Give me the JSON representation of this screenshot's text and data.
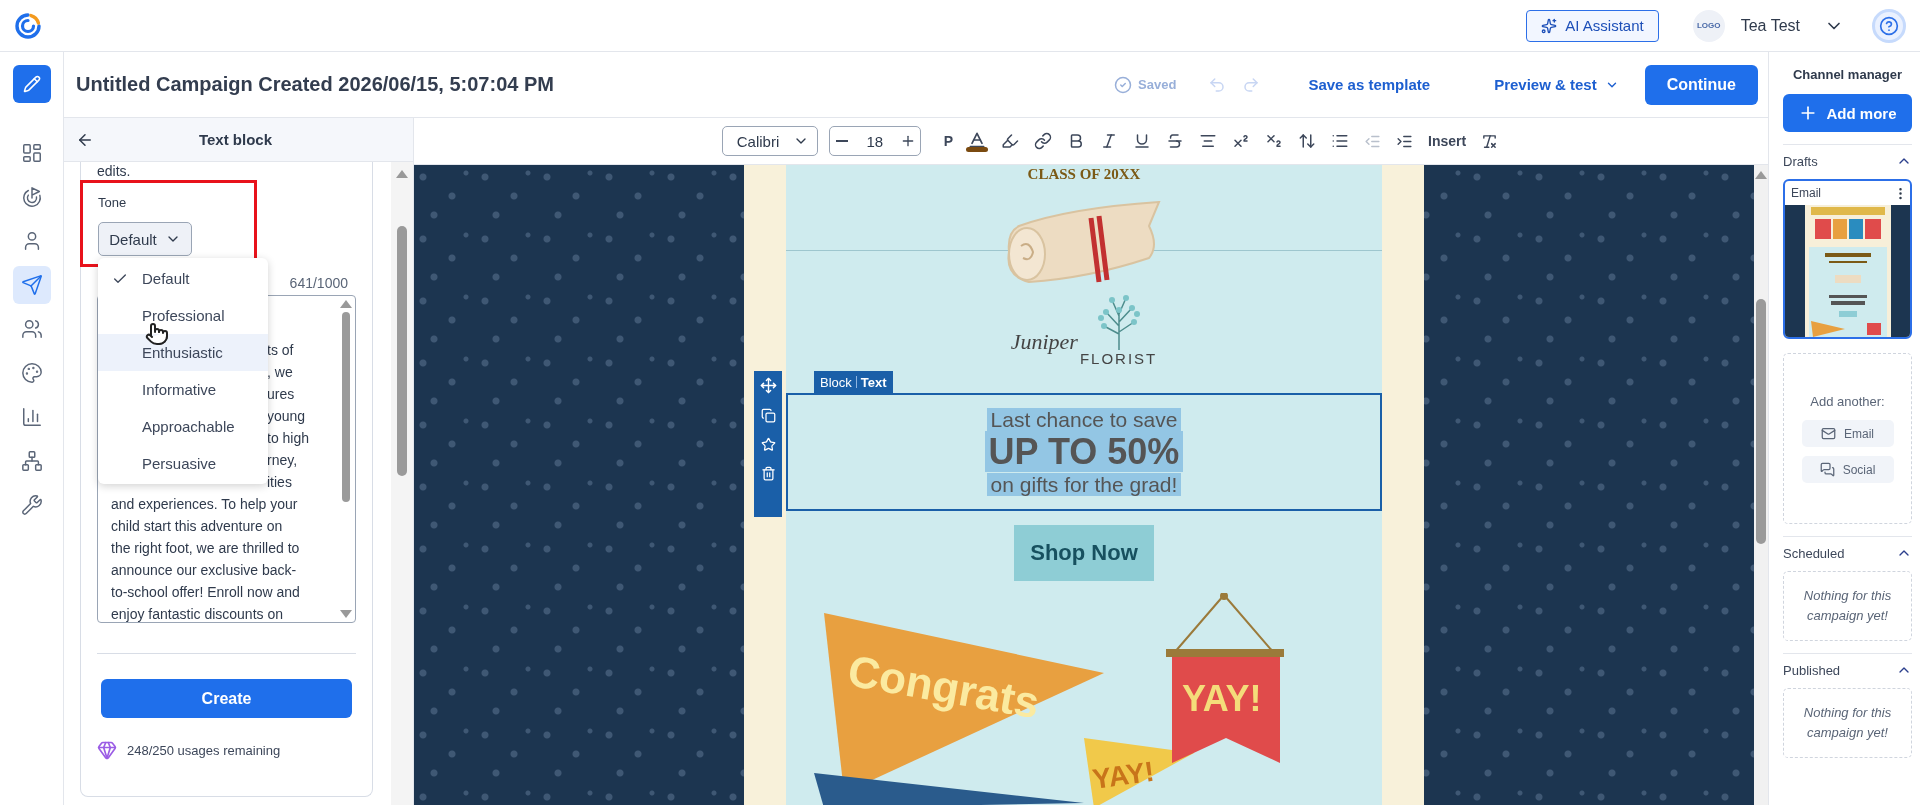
{
  "header": {
    "ai_button": "AI Assistant",
    "account_logo": "LOGO",
    "account_name": "Tea Test"
  },
  "nav": [
    {
      "kind": "layout",
      "selected": false
    },
    {
      "kind": "target",
      "selected": false
    },
    {
      "kind": "person",
      "selected": false
    },
    {
      "kind": "send",
      "selected": true
    },
    {
      "kind": "people",
      "selected": false
    },
    {
      "kind": "palette",
      "selected": false
    },
    {
      "kind": "chart",
      "selected": false
    },
    {
      "kind": "network",
      "selected": false
    },
    {
      "kind": "wrench",
      "selected": false
    }
  ],
  "title": "Untitled Campaign Created 2026/06/15, 5:07:04 PM",
  "actions": {
    "saved": {
      "label": "Saved",
      "disabled": true
    },
    "undo_disabled": true,
    "redo_disabled": true,
    "save_template": "Save as template",
    "preview": "Preview & test",
    "continue": "Continue"
  },
  "panel": {
    "title": "Text block",
    "intro_tail": "edits.",
    "tone_label": "Tone",
    "tone_value": "Default",
    "counter": "641/1000",
    "tone_options": [
      {
        "label": "Default",
        "selected": true,
        "highlighted": false
      },
      {
        "label": "Professional",
        "selected": false,
        "highlighted": false
      },
      {
        "label": "Enthusiastic",
        "selected": false,
        "highlighted": true
      },
      {
        "label": "Informative",
        "selected": false,
        "highlighted": false
      },
      {
        "label": "Approachable",
        "selected": false,
        "highlighted": false
      },
      {
        "label": "Persuasive",
        "selected": false,
        "highlighted": false
      }
    ],
    "text_lines": [
      {
        "kind": "tail",
        "text": "ts of"
      },
      {
        "kind": "tail",
        "text": ", we"
      },
      {
        "kind": "tail",
        "text": "ures"
      },
      {
        "kind": "tail",
        "text": "young"
      },
      {
        "kind": "tail",
        "text": "to high"
      },
      {
        "kind": "tail",
        "text": "rney,"
      },
      {
        "kind": "tail",
        "text": "ities"
      },
      {
        "kind": "full",
        "text": "and experiences. To help your"
      },
      {
        "kind": "full",
        "text": "child start this adventure on"
      },
      {
        "kind": "full",
        "text": "the right foot, we are thrilled to"
      },
      {
        "kind": "full",
        "text": "announce our exclusive back-"
      },
      {
        "kind": "full",
        "text": "to-school offer! Enroll now and"
      },
      {
        "kind": "full",
        "text": "enjoy fantastic discounts on"
      }
    ],
    "create": "Create",
    "usage": "248/250 usages remaining"
  },
  "toolbar": {
    "font": "Calibri",
    "size": "18",
    "paragraph": "P",
    "insert": "Insert",
    "outdent_disabled": true
  },
  "email": {
    "class_line": "CLASS OF 20XX",
    "logo_script": "Juniper",
    "logo_caps": "FLORIST",
    "block_tag": "Block",
    "block_type": "Text",
    "headline_lines": [
      {
        "kind": "lead",
        "text": "Last chance to save"
      },
      {
        "kind": "big",
        "text": "UP TO 50%"
      },
      {
        "kind": "lead",
        "text": "on gifts for the grad!"
      }
    ],
    "cta": "Shop Now",
    "pennants": [
      "Congrats",
      "YAY!",
      "YAY!"
    ]
  },
  "channel_manager": {
    "title": "Channel manager",
    "add": "Add more",
    "sections": [
      {
        "kind": "drafts",
        "title": "Drafts",
        "expanded": true,
        "card_label": "Email",
        "add_another": "Add another:",
        "options": [
          {
            "kind": "email",
            "label": "Email"
          },
          {
            "kind": "social",
            "label": "Social"
          }
        ]
      },
      {
        "kind": "empty",
        "title": "Scheduled",
        "expanded": true,
        "empty_text": "Nothing for this campaign yet!"
      },
      {
        "kind": "empty",
        "title": "Published",
        "expanded": true,
        "empty_text": "Nothing for this campaign yet!"
      }
    ]
  }
}
